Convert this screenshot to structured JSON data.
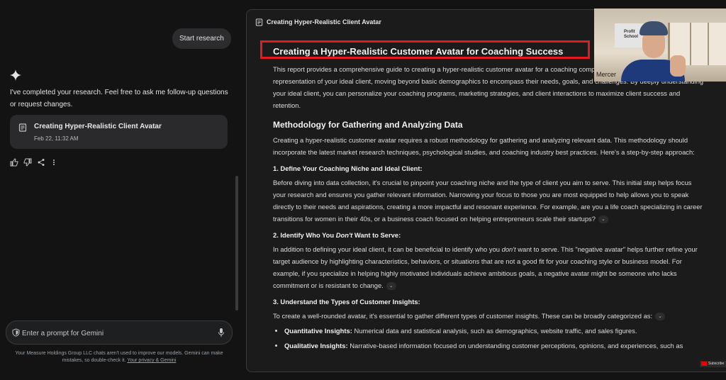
{
  "chat": {
    "user_message": "Start research",
    "reply_text": "I've completed your research. Feel free to ask me follow-up questions or request changes.",
    "card": {
      "title": "Creating Hyper-Realistic Client Avatar",
      "date": "Feb 22, 11:32 AM"
    },
    "actions": [
      "thumb-up-icon",
      "thumb-down-icon",
      "share-icon",
      "more-vert-icon"
    ],
    "prompt_placeholder": "Enter a prompt for Gemini",
    "disclaimer": "Your Measure Holdings Group LLC chats aren't used to improve our models. Gemini can make mistakes, so double-check it.",
    "privacy_link": "Your privacy & Gemini"
  },
  "report": {
    "header_title": "Creating Hyper-Realistic Client Avatar",
    "h1": "Creating a Hyper-Realistic Customer Avatar for Coaching Success",
    "intro": "This report provides a comprehensive guide to creating a hyper-realistic customer avatar for a coaching company, a meticulously crafted representation of your ideal client, moving beyond basic demographics to encompass their needs, goals, and challenges. By deeply understanding your ideal client, you can personalize your coaching programs, marketing strategies, and client interactions to maximize client success and retention.",
    "h2_method": "Methodology for Gathering and Analyzing Data",
    "method_text": "Creating a hyper-realistic customer avatar requires a robust methodology for gathering and analyzing relevant data. This methodology should incorporate the latest market research techniques, psychological studies, and coaching industry best practices. Here's a step-by-step approach:",
    "s1_title": "1. Define Your Coaching Niche and Ideal Client:",
    "s1_text": "Before diving into data collection, it's crucial to pinpoint your coaching niche and the type of client you aim to serve. This initial step helps focus your research and ensures you gather relevant information. Narrowing your focus to those you are most equipped to help allows you to speak directly to their needs and aspirations, creating a more impactful and resonant experience. For example, are you a life coach specializing in career transitions for women in their 40s, or a business coach focused on helping entrepreneurs scale their startups?",
    "s2_title_a": "2. Identify Who You ",
    "s2_title_em": "Don't",
    "s2_title_b": " Want to Serve:",
    "s2_text_a": "In addition to defining your ideal client, it can be beneficial to identify who you ",
    "s2_text_em": "don't",
    "s2_text_b": " want to serve. This \"negative avatar\"  helps further refine your target audience by highlighting characteristics, behaviors, or situations that are not a good fit for your coaching style or business model. For example, if you specialize in helping highly motivated individuals achieve ambitious goals, a negative avatar might be someone who lacks commitment or is resistant to change.",
    "s3_title": "3. Understand the Types of Customer Insights:",
    "s3_text": "To create a well-rounded avatar, it's essential to gather different types of customer insights. These can be broadly categorized as:",
    "bullets": [
      {
        "label": "Quantitative Insights:",
        "text": " Numerical data and statistical analysis, such as demographics, website traffic, and sales figures."
      },
      {
        "label": "Qualitative Insights:",
        "text": " Narrative-based information focused on understanding customer perceptions, opinions, and experiences, such as"
      }
    ]
  },
  "webcam": {
    "name": "Mercer",
    "poster_text": "Profit School"
  },
  "badge": {
    "label": "Subscribe"
  },
  "colors": {
    "background": "#131314",
    "panel": "#1b1b1c",
    "highlight_box": "#e21b23"
  }
}
